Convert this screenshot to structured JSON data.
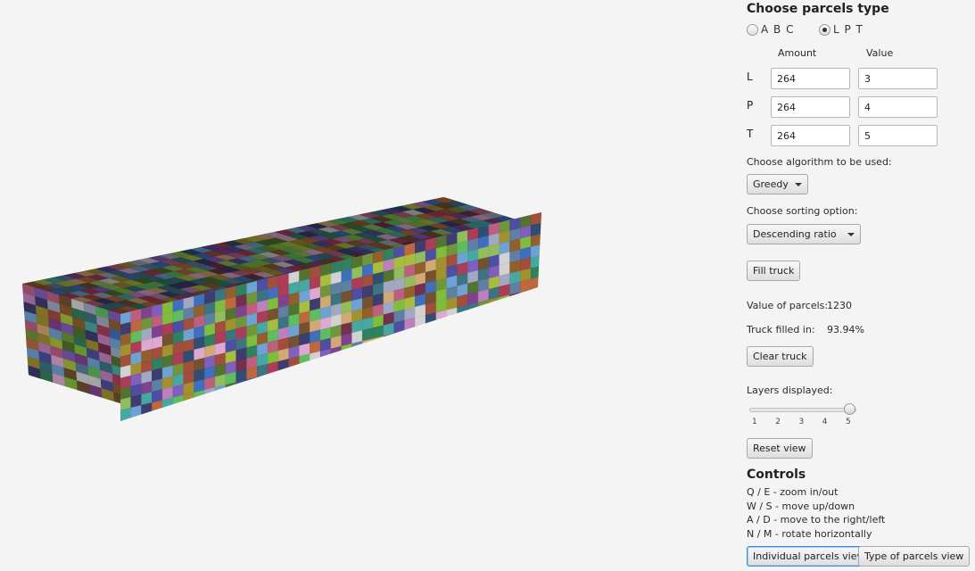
{
  "panel": {
    "parcels_type_title": "Choose parcels type",
    "radio_options": [
      {
        "label": "A B C",
        "selected": false
      },
      {
        "label": "L P T",
        "selected": true
      }
    ],
    "amount_header": "Amount",
    "value_header": "Value",
    "rows": [
      {
        "label": "L",
        "amount": "264",
        "value": "3"
      },
      {
        "label": "P",
        "amount": "264",
        "value": "4"
      },
      {
        "label": "T",
        "amount": "264",
        "value": "5"
      }
    ],
    "algorithm_label": "Choose algorithm to be used:",
    "algorithm_selected": "Greedy",
    "sorting_label": "Choose sorting option:",
    "sorting_selected": "Descending ratio",
    "fill_button": "Fill truck",
    "value_of_parcels_label": "Value of parcels:",
    "value_of_parcels": "1230",
    "truck_filled_label": "Truck filled in:",
    "truck_filled": "93.94%",
    "clear_button": "Clear truck",
    "layers_label": "Layers displayed:",
    "layers_ticks": [
      "1",
      "2",
      "3",
      "4",
      "5"
    ],
    "layers_value": 5,
    "layers_min": 1,
    "layers_max": 5,
    "reset_button": "Reset view",
    "controls_title": "Controls",
    "controls": [
      "Q / E - zoom in/out",
      "W / S - move up/down",
      "A / D - move to the right/left",
      "N / M - rotate horizontally"
    ],
    "individual_view_button": "Individual parcels view",
    "type_view_button": "Type of parcels view"
  },
  "colors": {
    "background": "#f4f4f4",
    "focus": "#3c8cd8"
  },
  "truck_palette": [
    "#3b6e7a",
    "#6b8f3a",
    "#a33a55",
    "#8b5a2b",
    "#4a4a9a",
    "#7a3f86",
    "#2f7a5a",
    "#9a8a2e",
    "#b45a7a",
    "#5a7a9a",
    "#7ab43c",
    "#c8a06e",
    "#44a09a",
    "#9a4a3a",
    "#6a9ac8",
    "#c8c8c8",
    "#3a3a6a",
    "#8ab45a",
    "#b47ab4",
    "#5ab45a",
    "#7a5ab4",
    "#a0b43c",
    "#3c6ab4",
    "#b4643c",
    "#6e2e4a",
    "#2e4a6e",
    "#4e6e2e",
    "#6e4e2e",
    "#9aa0b8",
    "#d2a0c8"
  ]
}
